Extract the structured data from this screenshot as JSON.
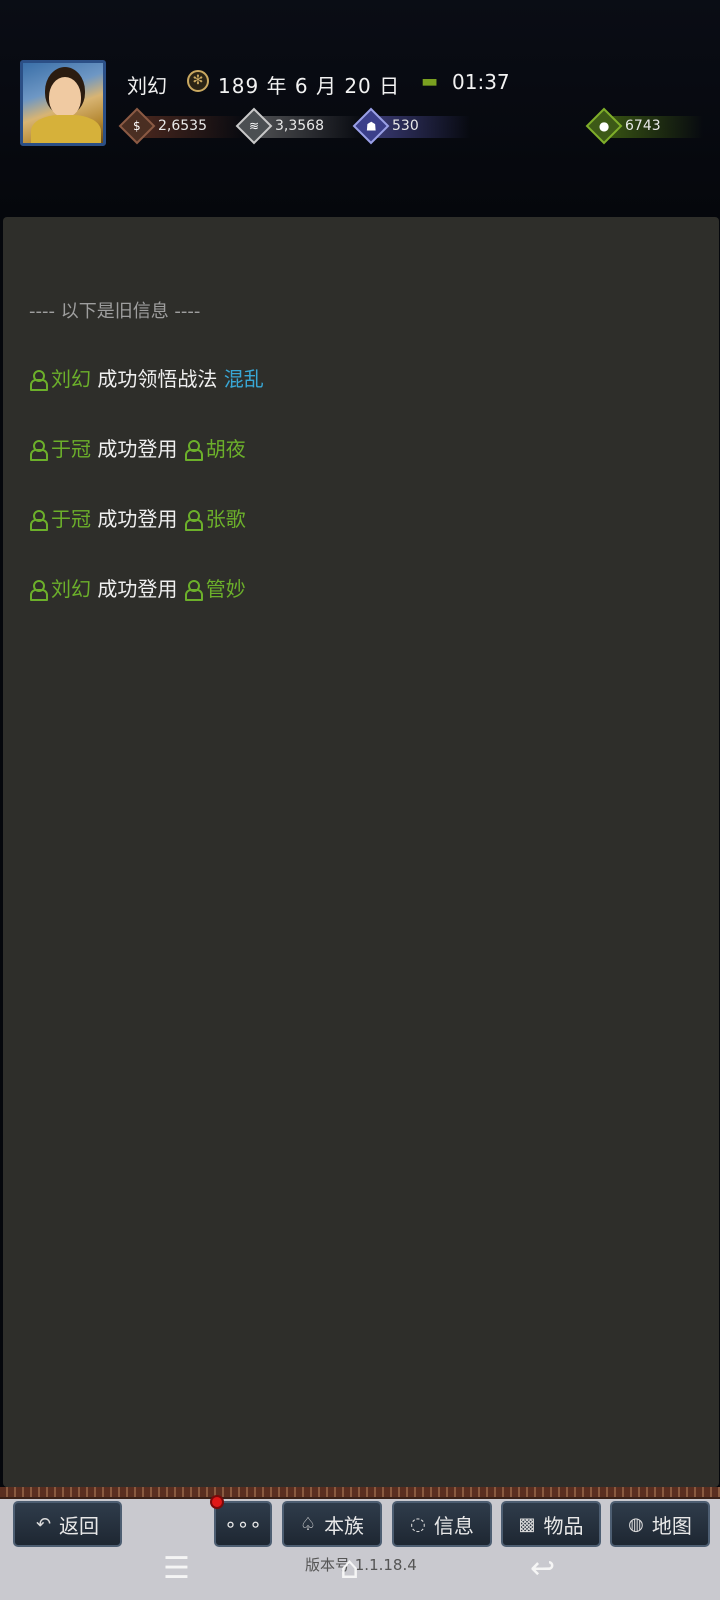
{
  "header": {
    "name": "刘幻",
    "date": "189 年 6 月 20 日",
    "time": "01:37",
    "stats": {
      "money": "2,6535",
      "food": "3,3568",
      "troops": "530",
      "gold": "6743"
    }
  },
  "messages": {
    "old_info": "---- 以下是旧信息 ----",
    "items": [
      {
        "actor": "刘幻",
        "action": "成功领悟战法",
        "target": "混乱"
      },
      {
        "actor": "于冠",
        "action": "成功登用",
        "target": "胡夜"
      },
      {
        "actor": "于冠",
        "action": "成功登用",
        "target": "张歌"
      },
      {
        "actor": "刘幻",
        "action": "成功登用",
        "target": "管妙"
      }
    ]
  },
  "toolbar": {
    "back": "返回",
    "more": "∘∘∘",
    "clan": "本族",
    "info": "信息",
    "items": "物品",
    "map": "地图"
  },
  "footer": {
    "version": "版本号 1.1.18.4"
  }
}
